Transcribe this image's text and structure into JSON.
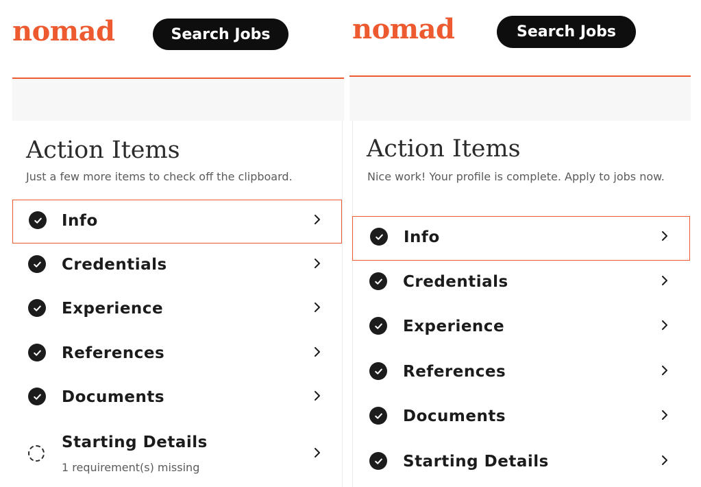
{
  "screens": [
    {
      "logo": "nomad",
      "search_button": "Search Jobs",
      "title": "Action Items",
      "subtitle": "Just a few more items to check off the clipboard.",
      "items": [
        {
          "label": "Info",
          "status": "complete",
          "selected": true
        },
        {
          "label": "Credentials",
          "status": "complete"
        },
        {
          "label": "Experience",
          "status": "complete"
        },
        {
          "label": "References",
          "status": "complete"
        },
        {
          "label": "Documents",
          "status": "complete"
        },
        {
          "label": "Starting Details",
          "status": "incomplete",
          "note": "1 requirement(s) missing"
        }
      ]
    },
    {
      "logo": "nomad",
      "search_button": "Search Jobs",
      "title": "Action Items",
      "subtitle": "Nice work! Your profile is complete. Apply to jobs now.",
      "items": [
        {
          "label": "Info",
          "status": "complete",
          "selected": true
        },
        {
          "label": "Credentials",
          "status": "complete"
        },
        {
          "label": "Experience",
          "status": "complete"
        },
        {
          "label": "References",
          "status": "complete"
        },
        {
          "label": "Documents",
          "status": "complete"
        },
        {
          "label": "Starting Details",
          "status": "complete"
        }
      ]
    }
  ],
  "colors": {
    "brand": "#ee5a2f",
    "button_bg": "#0e0e0e",
    "check_bg": "#1c1c1c",
    "band_bg": "#f7f7f7"
  },
  "icons": {
    "complete": "check-circle-icon",
    "incomplete": "dashed-circle-icon",
    "row_action": "chevron-right-icon"
  }
}
